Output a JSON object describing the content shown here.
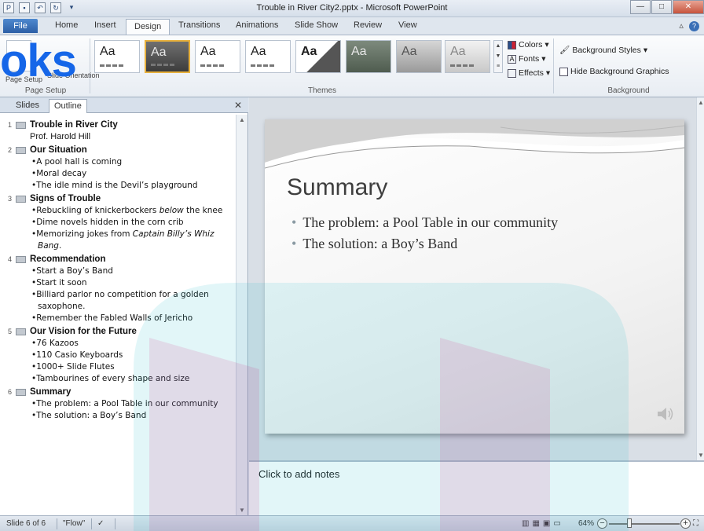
{
  "window": {
    "title": "Trouble in River City2.pptx - Microsoft PowerPoint",
    "controls": [
      "minimize-icon",
      "maximize-icon",
      "close-icon"
    ]
  },
  "quick_access": [
    "powerpoint-logo-icon",
    "save-icon",
    "undo-icon",
    "redo-icon",
    "customize-icon"
  ],
  "ribbon_tabs": [
    "File",
    "Home",
    "Insert",
    "Design",
    "Transitions",
    "Animations",
    "Slide Show",
    "Review",
    "View"
  ],
  "active_tab": "Design",
  "ribbon": {
    "page_setup_group": "Page Setup",
    "page_setup_button": "Page Setup",
    "orientation_button": "Slide Orientation",
    "themes_group_label": "Themes",
    "theme_sample": "Aa",
    "colors": "Colors",
    "fonts": "Fonts",
    "effects": "Effects",
    "background_styles": "Background Styles",
    "hide_background": "Hide Background Graphics",
    "background_group_label": "Background"
  },
  "watermark_text": "oks",
  "pane": {
    "tabs": [
      "Slides",
      "Outline"
    ],
    "active": "Outline"
  },
  "outline": [
    {
      "num": "1",
      "title": "Trouble in River City",
      "subtitle": "Prof. Harold Hill"
    },
    {
      "num": "2",
      "title": "Our Situation",
      "bullets": [
        "A pool hall is coming",
        "Moral decay",
        "The idle mind is the Devil’s playground"
      ]
    },
    {
      "num": "3",
      "title": "Signs of Trouble"
    },
    {
      "num": "4",
      "title": "Recommendation",
      "bullets": [
        "Start a Boy’s Band",
        "Start it soon",
        "Billiard parlor no competition for a golden",
        "saxophone.",
        "Remember the Fabled Walls of Jericho"
      ]
    },
    {
      "num": "5",
      "title": "Our Vision for the Future",
      "bullets": [
        "76 Kazoos",
        "110 Casio Keyboards",
        "1000+ Slide Flutes",
        "Tambourines of every shape and size"
      ]
    },
    {
      "num": "6",
      "title": "Summary",
      "bullets": [
        "The problem:  a Pool Table in our community",
        "The solution:  a Boy’s Band"
      ]
    }
  ],
  "slide3_lines": {
    "l1a": "Rebuckling of knickerbockers ",
    "l1b": "below",
    "l1c": " the knee",
    "l2": "Dime novels hidden in the corn crib",
    "l3a": "Memorizing jokes from ",
    "l3b": "Captain Billy’s Whiz",
    "l4": "Bang",
    "l4b": "."
  },
  "slide": {
    "title": "Summary",
    "bullets": [
      "The problem: a Pool Table in our community",
      "The solution: a Boy’s Band"
    ]
  },
  "notes_placeholder": "Click to add notes",
  "status": {
    "slide_info": "Slide 6 of 6",
    "theme_name": "\"Flow\"",
    "zoom": "64%"
  }
}
